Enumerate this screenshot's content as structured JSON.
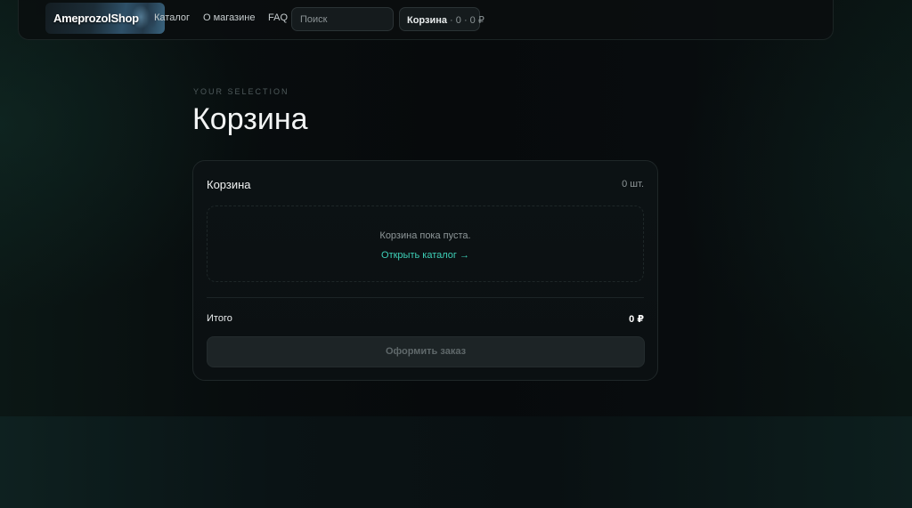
{
  "header": {
    "logo_text": "AmeprozolShop",
    "nav": [
      {
        "label": "Каталог"
      },
      {
        "label": "О магазине"
      },
      {
        "label": "FAQ"
      }
    ],
    "search": {
      "placeholder": "Поиск",
      "value": ""
    },
    "cart": {
      "label": "Корзина",
      "summary": " · 0 · 0 ₽"
    }
  },
  "main": {
    "eyebrow": "YOUR SELECTION",
    "title": "Корзина"
  },
  "cart_card": {
    "title": "Корзина",
    "count": "0 шт.",
    "empty_text": "Корзина пока пуста.",
    "catalog_link": "Открыть каталог →",
    "total_label": "Итого",
    "total_value": "0 ₽",
    "checkout_label": "Оформить заказ"
  },
  "colors": {
    "accent": "#3ed0b8",
    "background": "#080c0e",
    "text_primary": "#f2f4f4",
    "text_muted": "#8f9799"
  }
}
